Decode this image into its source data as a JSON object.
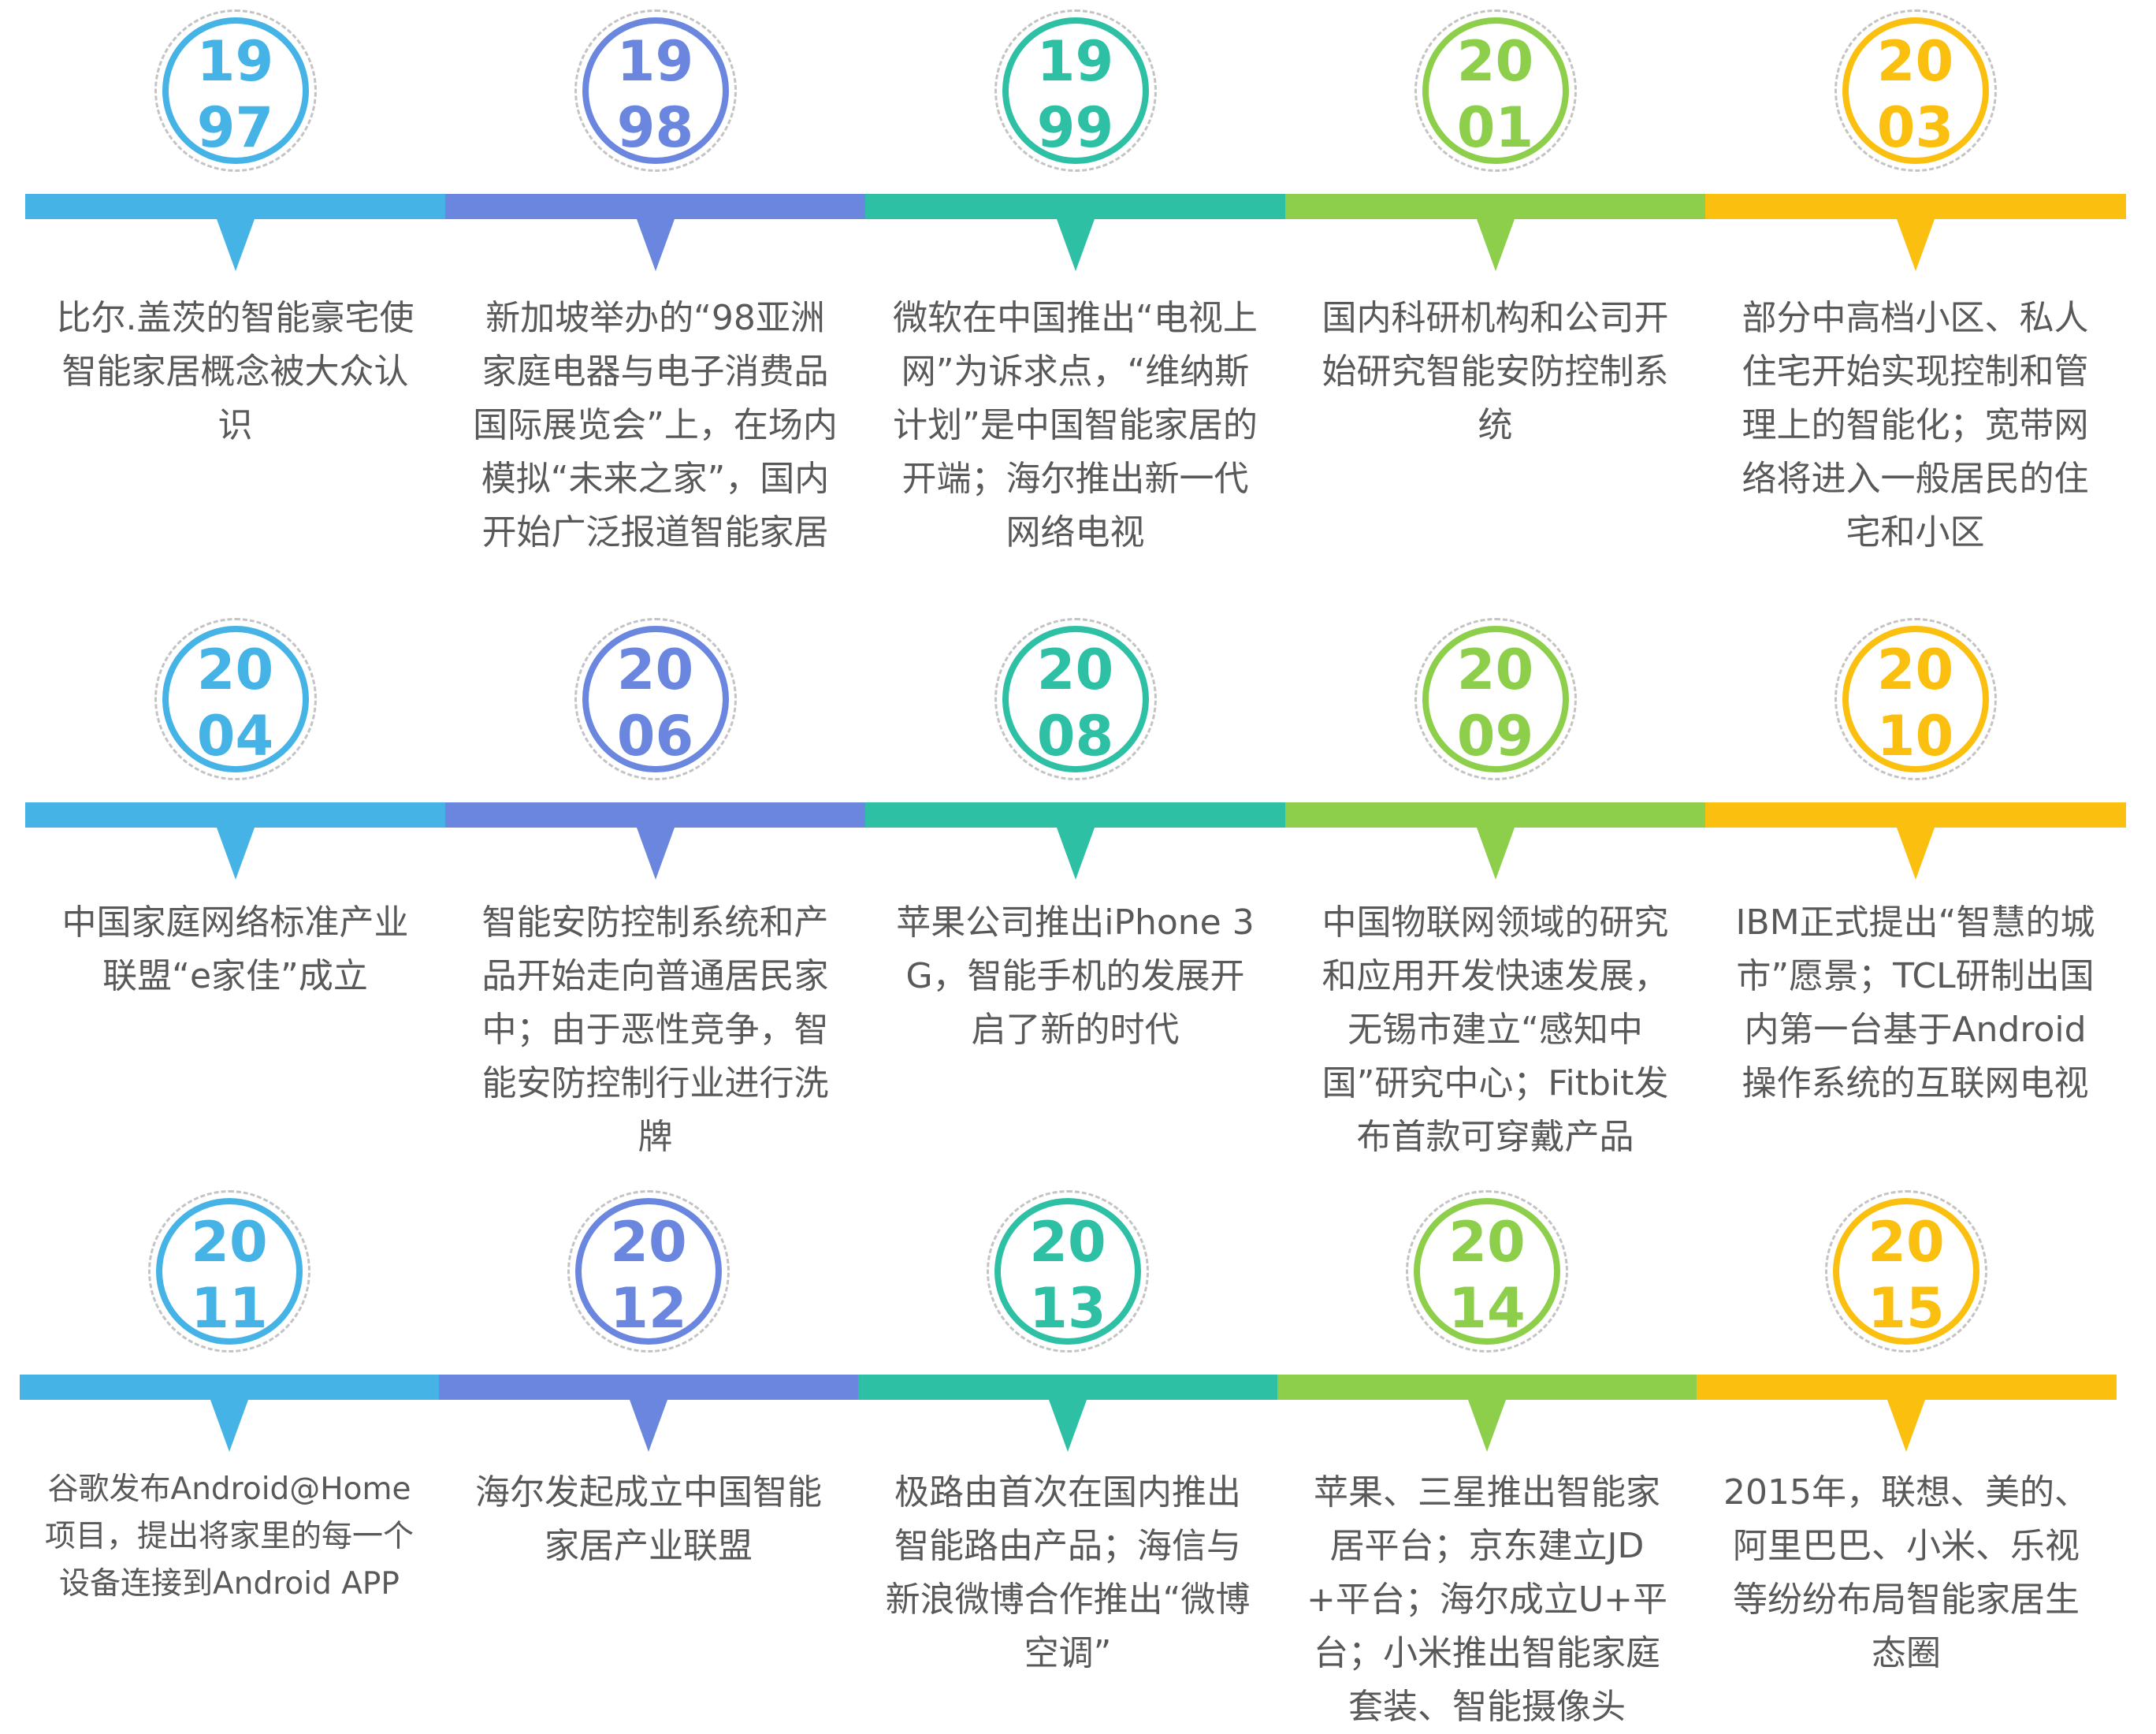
{
  "colors": {
    "blue": "#45b3e6",
    "indigo": "#6a86df",
    "teal": "#2dc0a4",
    "green": "#8dcf4b",
    "yellow": "#fbc00f",
    "text": "#595959"
  },
  "rows": [
    {
      "events": [
        {
          "year_top": "19",
          "year_bottom": "97",
          "color": "blue",
          "text": "比尔.盖茨的智能豪宅使智能家居概念被大众认识"
        },
        {
          "year_top": "19",
          "year_bottom": "98",
          "color": "indigo",
          "text": "新加坡举办的“98亚洲家庭电器与电子消费品国际展览会”上，在场内模拟“未来之家”，国内开始广泛报道智能家居"
        },
        {
          "year_top": "19",
          "year_bottom": "99",
          "color": "teal",
          "text": "微软在中国推出“电视上网”为诉求点，“维纳斯计划”是中国智能家居的开端；海尔推出新一代网络电视"
        },
        {
          "year_top": "20",
          "year_bottom": "01",
          "color": "green",
          "text": "国内科研机构和公司开始研究智能安防控制系统"
        },
        {
          "year_top": "20",
          "year_bottom": "03",
          "color": "yellow",
          "text": "部分中高档小区、私人住宅开始实现控制和管理上的智能化；宽带网络将进入一般居民的住宅和小区"
        }
      ]
    },
    {
      "events": [
        {
          "year_top": "20",
          "year_bottom": "04",
          "color": "blue",
          "text": "中国家庭网络标准产业联盟“e家佳”成立"
        },
        {
          "year_top": "20",
          "year_bottom": "06",
          "color": "indigo",
          "text": "智能安防控制系统和产品开始走向普通居民家中；由于恶性竞争，智能安防控制行业进行洗牌"
        },
        {
          "year_top": "20",
          "year_bottom": "08",
          "color": "teal",
          "text": "苹果公司推出iPhone 3G，智能手机的发展开启了新的时代"
        },
        {
          "year_top": "20",
          "year_bottom": "09",
          "color": "green",
          "text": "中国物联网领域的研究和应用开发快速发展，无锡市建立“感知中国”研究中心；Fitbit发布首款可穿戴产品"
        },
        {
          "year_top": "20",
          "year_bottom": "10",
          "color": "yellow",
          "text": "IBM正式提出“智慧的城市”愿景；TCL研制出国内第一台基于Android操作系统的互联网电视"
        }
      ]
    },
    {
      "events": [
        {
          "year_top": "20",
          "year_bottom": "11",
          "color": "blue",
          "text": "谷歌发布Android@Home项目，提出将家里的每一个设备连接到Android APP"
        },
        {
          "year_top": "20",
          "year_bottom": "12",
          "color": "indigo",
          "text": "海尔发起成立中国智能家居产业联盟"
        },
        {
          "year_top": "20",
          "year_bottom": "13",
          "color": "teal",
          "text": "极路由首次在国内推出智能路由产品；海信与新浪微博合作推出“微博空调”"
        },
        {
          "year_top": "20",
          "year_bottom": "14",
          "color": "green",
          "text": "苹果、三星推出智能家居平台；京东建立JD+平台；海尔成立U+平台；小米推出智能家庭套装、智能摄像头"
        },
        {
          "year_top": "20",
          "year_bottom": "15",
          "color": "yellow",
          "text": "2015年，联想、美的、阿里巴巴、小米、乐视等纷纷布局智能家居生态圈"
        }
      ]
    }
  ]
}
